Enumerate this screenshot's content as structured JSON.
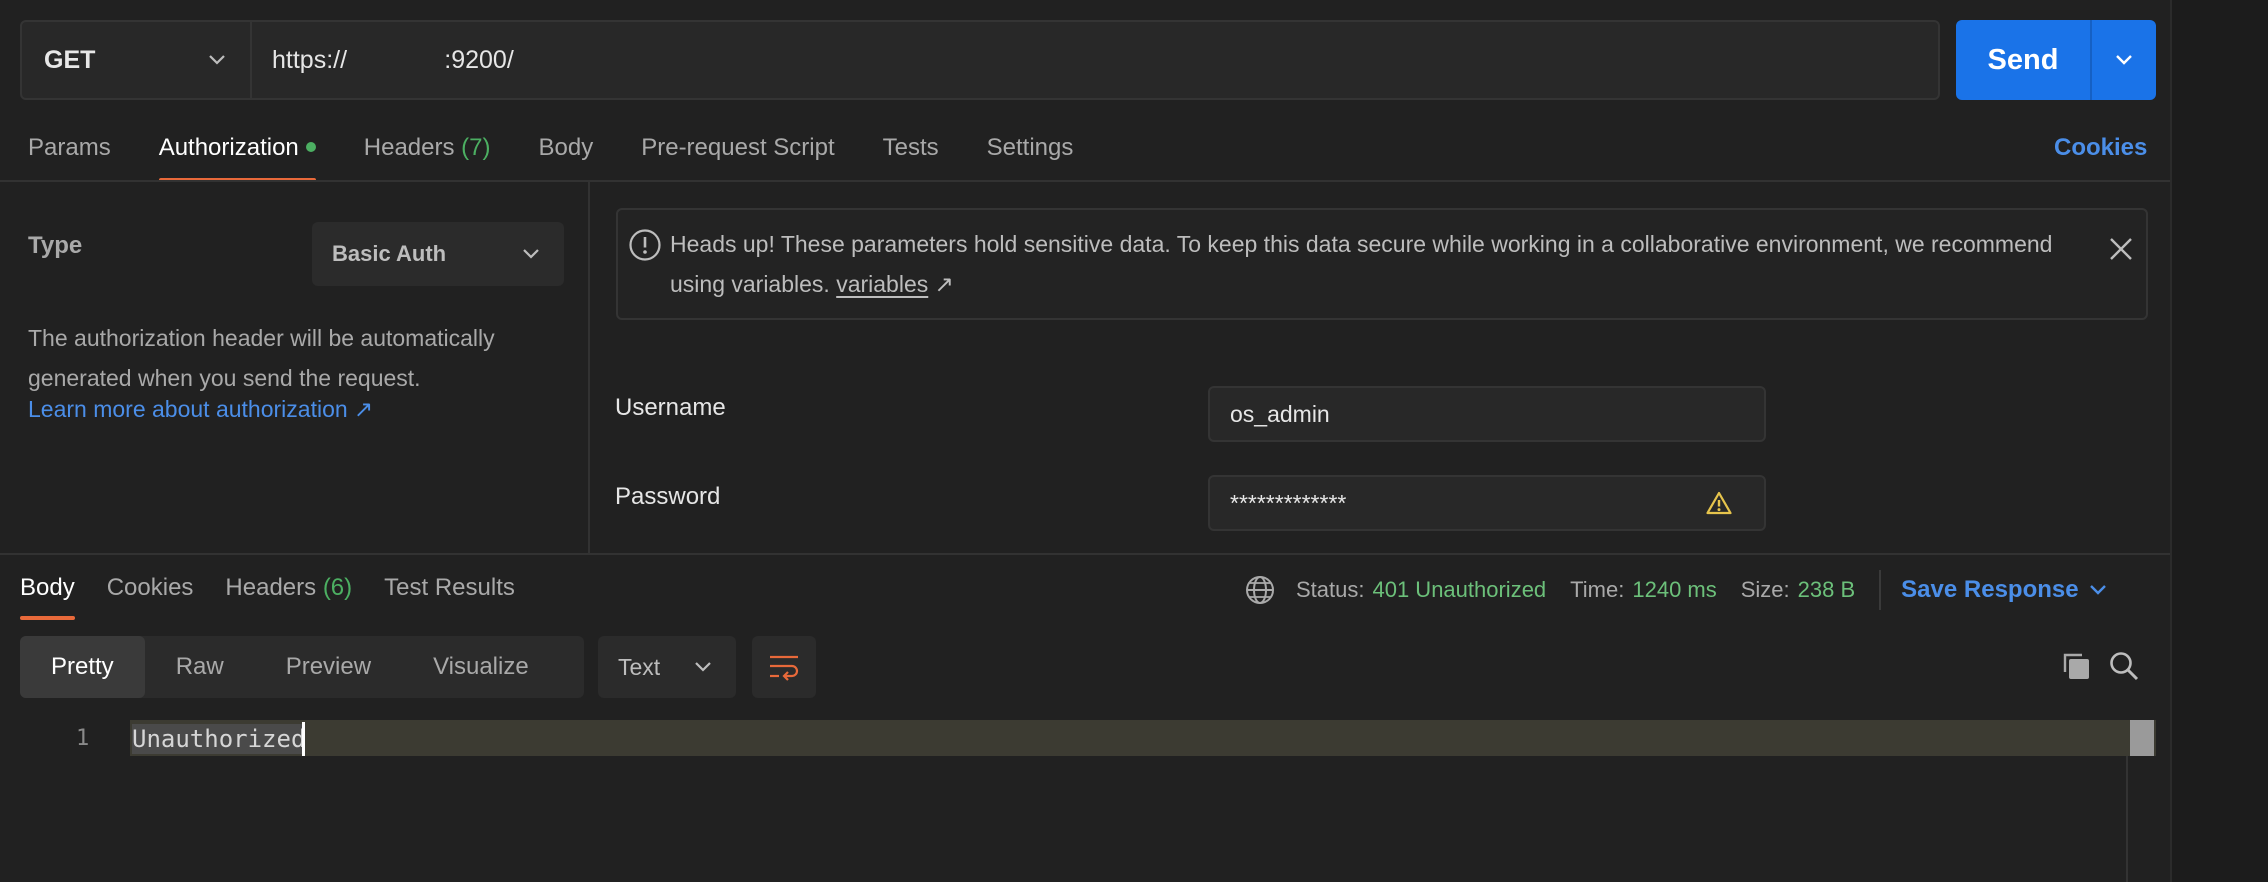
{
  "request": {
    "method": "GET",
    "url": "https://              :9200/",
    "send_label": "Send"
  },
  "tabs": [
    {
      "label": "Params"
    },
    {
      "label": "Authorization"
    },
    {
      "label": "Headers",
      "count": "(7)"
    },
    {
      "label": "Body"
    },
    {
      "label": "Pre-request Script"
    },
    {
      "label": "Tests"
    },
    {
      "label": "Settings"
    }
  ],
  "cookies_label": "Cookies",
  "auth": {
    "type_label": "Type",
    "type_value": "Basic Auth",
    "description": "The authorization header will be automatically generated when you send the request.",
    "learn_more": "Learn more about authorization ↗",
    "notice": "Heads up! These parameters hold sensitive data. To keep this data secure while working in a collaborative environment, we recommend using variables.",
    "notice_link": "variables",
    "notice_link_arrow": "↗",
    "username_label": "Username",
    "username_value": "os_admin",
    "password_label": "Password",
    "password_value": "*************"
  },
  "response": {
    "tabs": [
      {
        "label": "Body"
      },
      {
        "label": "Cookies"
      },
      {
        "label": "Headers",
        "count": "(6)"
      },
      {
        "label": "Test Results"
      }
    ],
    "status_label": "Status:",
    "status_value": "401 Unauthorized",
    "time_label": "Time:",
    "time_value": "1240 ms",
    "size_label": "Size:",
    "size_value": "238 B",
    "save_label": "Save Response",
    "formats": [
      "Pretty",
      "Raw",
      "Preview",
      "Visualize"
    ],
    "language": "Text",
    "line_number": "1",
    "body_text": "Unauthorized"
  },
  "colors": {
    "accent_orange": "#e8693a",
    "link_blue": "#4b8ee8",
    "send_blue": "#1a73e8",
    "status_green": "#6cc07a"
  }
}
